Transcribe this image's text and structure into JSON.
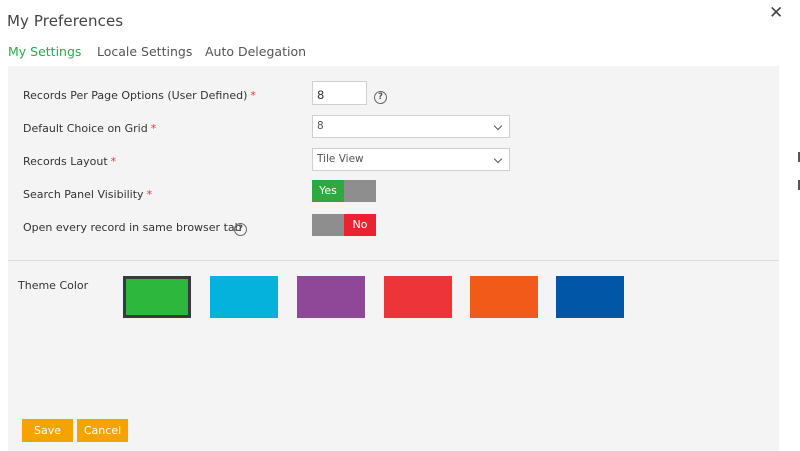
{
  "dialog": {
    "title": "My Preferences",
    "close_icon": "close-icon"
  },
  "tabs": [
    {
      "label": "My Settings",
      "active": true
    },
    {
      "label": "Locale Settings",
      "active": false
    },
    {
      "label": "Auto Delegation",
      "active": false
    }
  ],
  "settings": {
    "records_per_page": {
      "label": "Records Per Page Options (User Defined)",
      "required": "*",
      "value": "8",
      "help_icon": "?"
    },
    "default_choice": {
      "label": "Default Choice on Grid",
      "required": "*",
      "value": "8"
    },
    "records_layout": {
      "label": "Records Layout",
      "required": "*",
      "value": "Tile View"
    },
    "search_panel": {
      "label": "Search Panel Visibility",
      "required": "*",
      "state": "Yes"
    },
    "open_same_tab": {
      "label": "Open every record in same browser tab",
      "help_icon": "?",
      "state": "No"
    }
  },
  "theme": {
    "label": "Theme Color",
    "selected_index": 0,
    "colors": [
      "#2db83d",
      "#05b2db",
      "#8f4797",
      "#ec3439",
      "#f25a1a",
      "#0256a8"
    ]
  },
  "actions": {
    "save_label": "Save",
    "cancel_label": "Cancel"
  },
  "colors": {
    "accent_green": "#2ba84a",
    "button_orange": "#f5a300",
    "toggle_red": "#ea2330",
    "toggle_green": "#2ea940"
  }
}
